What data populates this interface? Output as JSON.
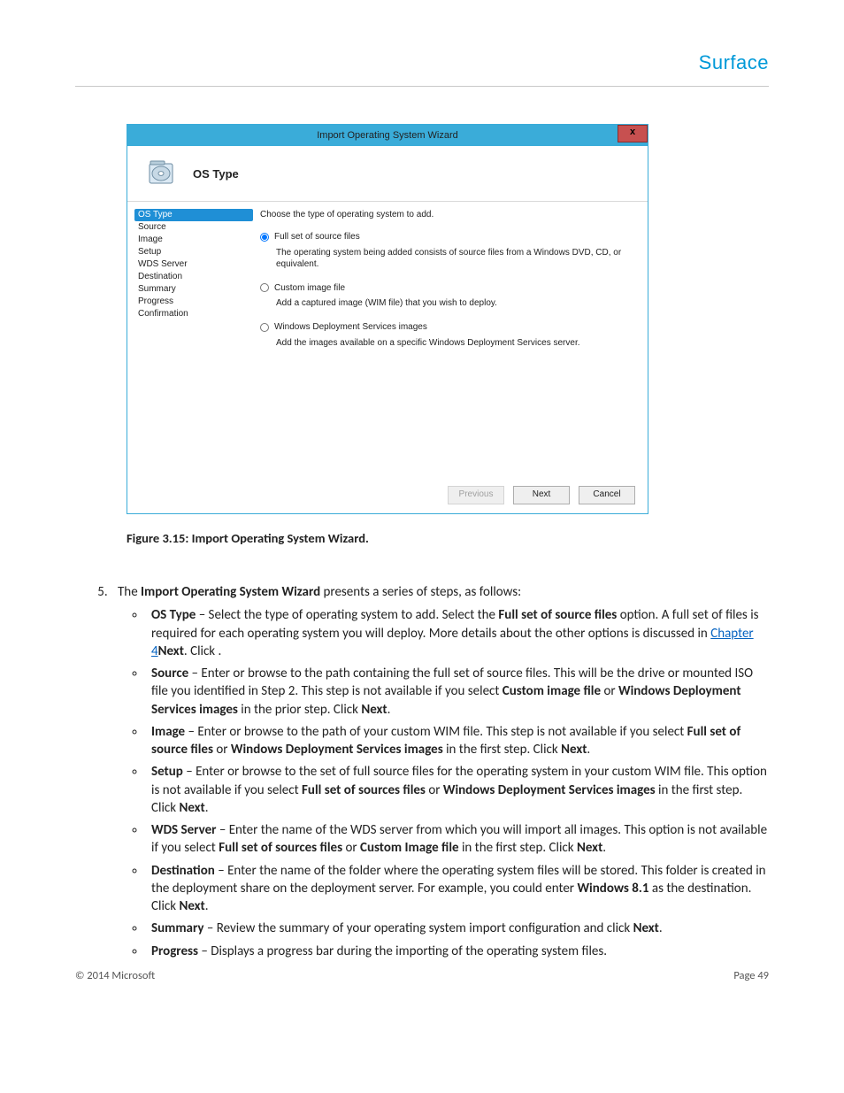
{
  "brand": "Surface",
  "wizard": {
    "title": "Import Operating System Wizard",
    "close": "x",
    "header_title": "OS Type",
    "nav": [
      "OS Type",
      "Source",
      "Image",
      "Setup",
      "WDS Server",
      "Destination",
      "Summary",
      "Progress",
      "Confirmation"
    ],
    "nav_selected_index": 0,
    "prompt": "Choose the type of operating system to add.",
    "options": [
      {
        "label": "Full set of source files",
        "desc": "The operating system being added consists of source files from a Windows DVD, CD, or equivalent.",
        "checked": true
      },
      {
        "label": "Custom image file",
        "desc": "Add a captured image (WIM file) that you wish to deploy.",
        "checked": false
      },
      {
        "label": "Windows Deployment Services images",
        "desc": "Add the images available on a specific Windows Deployment Services server.",
        "checked": false
      }
    ],
    "buttons": {
      "previous": "Previous",
      "next": "Next",
      "cancel": "Cancel"
    }
  },
  "caption": "Figure 3.15: Import Operating System Wizard.",
  "list_start": 5,
  "step5": {
    "intro_pre": "The ",
    "intro_bold": "Import Operating System Wizard",
    "intro_post": " presents a series of steps, as follows:",
    "items": [
      {
        "term": "OS Type",
        "pre": " – Select the type of operating system to add. Select the ",
        "bold1": "Full set of source files",
        "mid1": " option. A full set of files is required for each operating system you will deploy. More details about the other options is discussed in ",
        "link": "Chapter 4",
        "mid2": ". Click ",
        "bold2": "Next",
        "post": "."
      },
      {
        "term": "Source",
        "pre": " – Enter or browse to the path containing the full set of source files. This will be the drive or mounted ISO file you identified in Step 2. This step is not available if you select ",
        "bold1": "Custom image file",
        "mid1": " or ",
        "bold2": "Windows Deployment Services images",
        "mid2": " in the prior step. Click ",
        "bold3": "Next",
        "post": "."
      },
      {
        "term": "Image",
        "pre": " – Enter or browse to the path of your custom WIM file. This step is not available if you select ",
        "bold1": "Full set of source files",
        "mid1": " or ",
        "bold2": "Windows Deployment Services images",
        "mid2": " in the first step. Click ",
        "bold3": "Next",
        "post": "."
      },
      {
        "term": "Setup",
        "pre": " – Enter or browse to the set of full source files for the operating system in your custom WIM file. This option is not available if you select ",
        "bold1": "Full set of sources files",
        "mid1": " or ",
        "bold2": "Windows Deployment Services images",
        "mid2": " in the first step. Click ",
        "bold3": "Next",
        "post": "."
      },
      {
        "term": "WDS Server",
        "pre": " – Enter the name of the WDS server from which you will import all images. This option is not available if you select ",
        "bold1": "Full set of sources files",
        "mid1": " or ",
        "bold2": "Custom Image file",
        "mid2": " in the first step. Click ",
        "bold3": "Next",
        "post": "."
      },
      {
        "term": "Destination",
        "pre": " – Enter the name of the folder where the operating system files will be stored. This folder is created in the deployment share on the deployment server. For example, you could enter ",
        "bold1": "Windows 8.1",
        "mid1": " as the destination. Click ",
        "bold2": "Next",
        "post": "."
      },
      {
        "term": "Summary",
        "pre": " – Review the summary of your operating system import configuration and click ",
        "bold1": "Next",
        "post": "."
      },
      {
        "term": "Progress",
        "pre": " – Displays a progress bar during the importing of the operating system files.",
        "post": ""
      }
    ]
  },
  "footer": {
    "left": "© 2014 Microsoft",
    "right": "Page 49"
  }
}
